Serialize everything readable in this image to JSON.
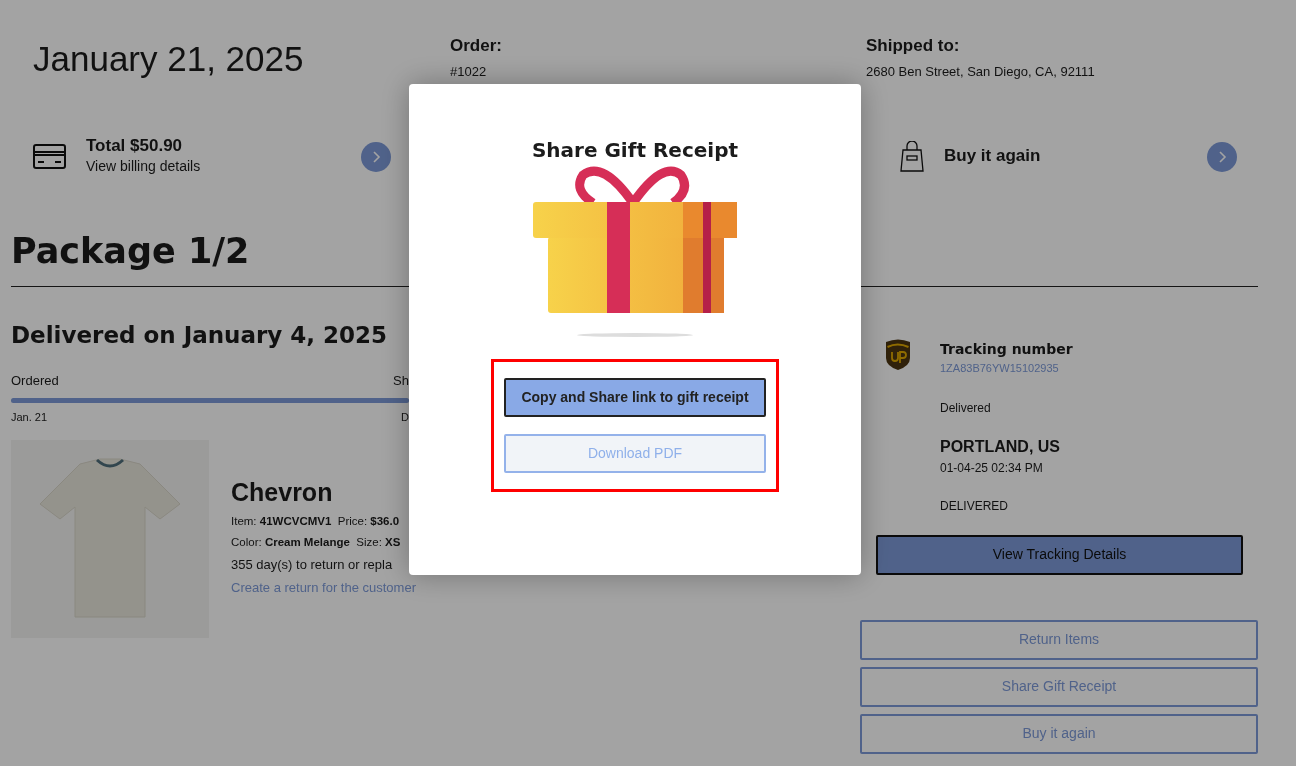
{
  "header": {
    "date": "January 21, 2025",
    "order_label": "Order:",
    "order_number": "#1022",
    "shipped_label": "Shipped to:",
    "address": "2680 Ben Street, San Diego, CA, 92111"
  },
  "summary_links": [
    {
      "kind": "billing",
      "title": "Total $50.90",
      "subtitle": "View billing details"
    },
    {
      "kind": "buy_again",
      "title": "Buy it again"
    }
  ],
  "package": {
    "title": "Package 1/2",
    "status_title": "Delivered on January 4, 2025",
    "progress_bar": {
      "level": 1
    },
    "progress": [
      {
        "label": "Ordered",
        "date": "Jan. 21"
      },
      {
        "label": "Sh",
        "date": "D"
      }
    ],
    "item": {
      "name": "Chevron",
      "detail_lines": [
        [
          {
            "label": "Item:",
            "value": "41WCVCMV1"
          },
          {
            "label": "Price:",
            "value": "$36.0"
          }
        ],
        [
          {
            "label": "Color:",
            "value": "Cream Melange"
          },
          {
            "label": "Size:",
            "value": "XS"
          }
        ]
      ],
      "return_window": "355 day(s) to return or repla",
      "return_link": "Create a return for the customer"
    }
  },
  "tracking": {
    "label": "Tracking number",
    "number": "1ZA83B76YW15102935",
    "status": "Delivered",
    "location": "PORTLAND, US",
    "time": "01-04-25 02:34 PM",
    "event": "DELIVERED",
    "button": "View Tracking Details"
  },
  "actions": [
    "Return Items",
    "Share Gift Receipt",
    "Buy it again"
  ],
  "modal": {
    "title": "Share Gift Receipt",
    "buttons": [
      {
        "label": "Copy and Share link to gift receipt",
        "kind": "primary"
      },
      {
        "label": "Download PDF",
        "kind": "outline"
      }
    ]
  }
}
